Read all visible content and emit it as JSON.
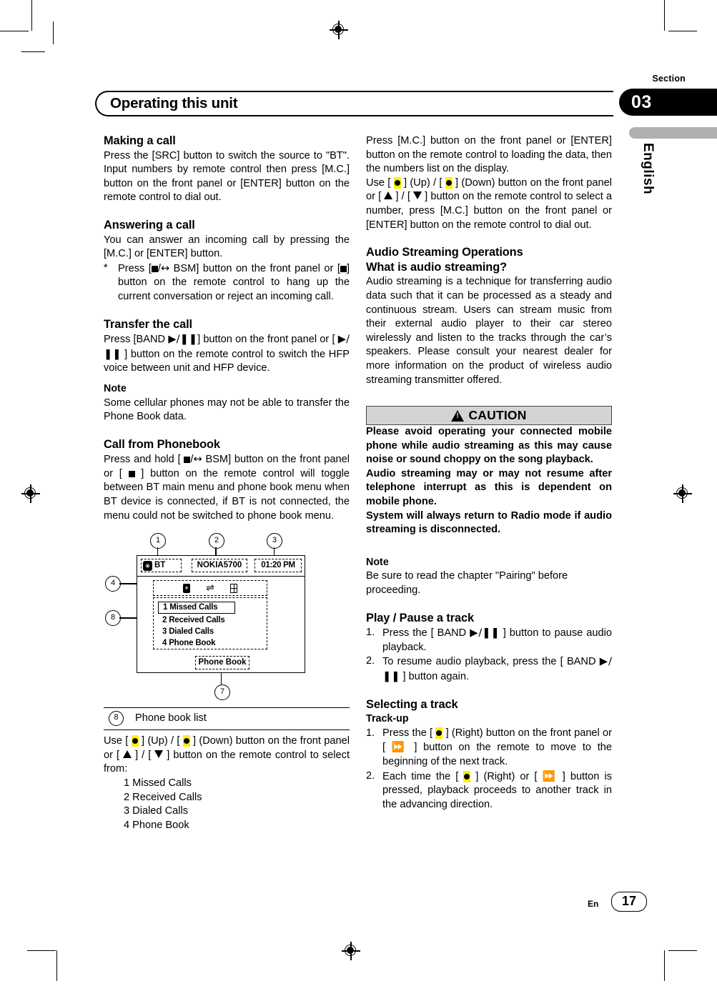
{
  "page": {
    "title": "Operating this unit",
    "section_word": "Section",
    "section_number": "03",
    "language": "English",
    "footer_lang": "En",
    "page_number": "17"
  },
  "left_column": {
    "making_a_call": {
      "heading": "Making a call",
      "body": "Press the [SRC] button to switch the source to \"BT\". Input numbers by remote control then press [M.C.] button on the front panel or [ENTER] button on the remote control to dial out."
    },
    "answering_a_call": {
      "heading": "Answering a call",
      "body": "You can answer an incoming call by pressing the [M.C.] or [ENTER] button.",
      "note_mark": "*",
      "note_part1": "Press [",
      "note_part2": "/",
      "note_part3": " BSM] button on the front panel or [",
      "note_part4": "] button on the remote control to hang up the current conversation or reject an incoming call."
    },
    "transfer_the_call": {
      "heading": "Transfer the call",
      "body_part1": "Press [BAND ",
      "body_part2": "] button on the front panel or [ ",
      "body_part3": " ] button on the remote control to switch the HFP voice between unit and HFP device.",
      "note_heading": "Note",
      "note_body": "Some cellular phones may not be able to transfer the Phone Book data."
    },
    "call_from_phonebook": {
      "heading": "Call from Phonebook",
      "body_part1": "Press and hold [ ",
      "body_part2": "/",
      "body_part3": " BSM] button on the front panel or [ ",
      "body_part4": " ] button on the remote control will toggle between BT main menu and phone book menu when BT device is connected, if BT is not connected, the menu could not be switched to phone book menu."
    },
    "diagram": {
      "callouts": [
        "1",
        "2",
        "3",
        "4",
        "8",
        "7"
      ],
      "status_bar": {
        "bt_label": "BT",
        "device_name": "NOKIA5700",
        "clock": "01:20 PM"
      },
      "menu_items": [
        "1  Missed Calls",
        "2  Received Calls",
        "3  Dialed Calls",
        "4  Phone Book"
      ],
      "footer_label": "Phone Book"
    },
    "caption": {
      "number": "8",
      "text": "Phone book list"
    },
    "phone_book_list": {
      "intro_part1": "Use [ ",
      "intro_part2": " ] (Up) / [ ",
      "intro_part3": " ] (Down) button on the front panel or [ ",
      "intro_part4": " ] / [ ",
      "intro_part5": " ] button on the remote control to select from:",
      "choices": [
        "1 Missed Calls",
        "2 Received Calls",
        "3 Dialed Calls",
        "4 Phone Book"
      ]
    }
  },
  "right_column": {
    "dial_out": {
      "body1": "Press [M.C.] button on the front panel or [ENTER] button on the remote control to loading the data, then the numbers list on the display.",
      "body2_part1": "Use [ ",
      "body2_part2": " ] (Up) / [ ",
      "body2_part3": " ] (Down) button on the front panel or [ ",
      "body2_part4": " ] / [ ",
      "body2_part5": " ] button on the remote control to select a number, press [M.C.] button on the front panel or [ENTER] button on the remote control to dial out."
    },
    "audio_streaming": {
      "heading": "Audio Streaming Operations",
      "subheading": "What is audio streaming?",
      "body": "Audio streaming is a technique for transferring audio data such that it can be processed as a steady and continuous stream. Users can stream music from their external audio player to their car stereo wirelessly and listen to the tracks through the car’s speakers. Please consult your nearest dealer for more information on the product of wireless audio streaming transmitter offered."
    },
    "caution": {
      "label": "CAUTION",
      "para1": "Please avoid operating your connected mobile phone while audio streaming as this may cause noise or sound choppy on the song playback.",
      "para2": "Audio streaming may or may not resume after telephone interrupt as this is dependent on mobile phone.",
      "para3": "System will always return to Radio mode if audio streaming is disconnected."
    },
    "note": {
      "heading": "Note",
      "body": "Be sure to read the chapter \"Pairing\" before proceeding."
    },
    "play_pause": {
      "heading": "Play / Pause a track",
      "item1_num": "1.",
      "item1_part1": "Press the [ BAND ",
      "item1_part2": " ] button to pause audio playback.",
      "item2_num": "2.",
      "item2_part1": "To resume audio playback, press the [ BAND ",
      "item2_part2": " ] button again."
    },
    "selecting_track": {
      "heading": "Selecting a track",
      "subheading": "Track-up",
      "item1_num": "1.",
      "item1_part1": "Press the [ ",
      "item1_part2": " ] (Right) button on the front panel or [ ",
      "item1_part3": " ] button on the remote to move to the beginning of the next track.",
      "item2_num": "2.",
      "item2_part1": "Each time the [ ",
      "item2_part2": " ] (Right) or [ ",
      "item2_part3": " ] button is pressed, playback proceeds to another track in the advancing direction."
    }
  },
  "colors": {
    "highlight": "#ffef00",
    "caution_bg": "#d4d4d4",
    "section_badge_bg": "#000000",
    "lang_bar": "#b0b0b0"
  }
}
